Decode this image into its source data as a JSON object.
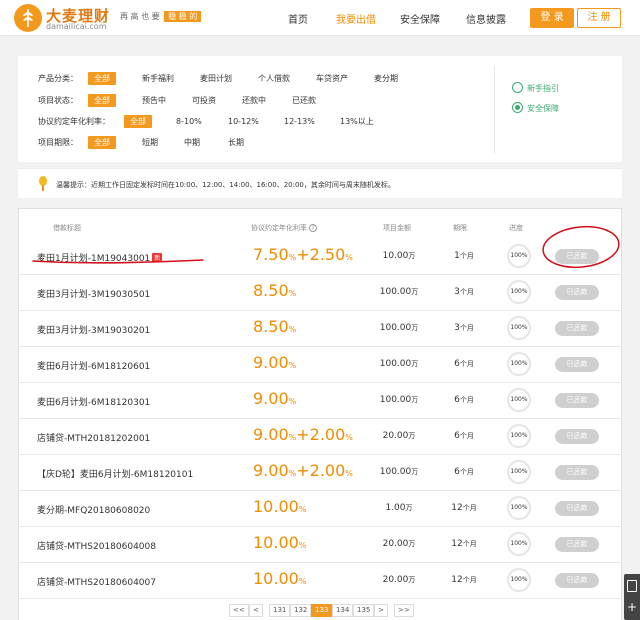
{
  "header": {
    "brand_name": "大麦理财",
    "brand_domain": "damailicai.com",
    "slogan": "再 高 也 要",
    "slogan_badge": "稳 稳 的",
    "nav": [
      {
        "label": "首页",
        "active": false
      },
      {
        "label": "我要出借",
        "active": true
      },
      {
        "label": "安全保障",
        "active": false
      },
      {
        "label": "信息披露",
        "active": false
      }
    ],
    "login_label": "登 录",
    "register_label": "注 册"
  },
  "filters": {
    "category": {
      "label": "产品分类：",
      "options": [
        "全部",
        "新手福利",
        "麦田计划",
        "个人借款",
        "车贷资产",
        "麦分期"
      ],
      "selected": "全部"
    },
    "status": {
      "label": "项目状态：",
      "options": [
        "全部",
        "预告中",
        "可投资",
        "还款中",
        "已还款"
      ],
      "selected": "全部"
    },
    "rate": {
      "label": "协议约定年化利率：",
      "options": [
        "全部",
        "8-10%",
        "10-12%",
        "12-13%",
        "13%以上"
      ],
      "selected": "全部"
    },
    "term": {
      "label": "项目期限：",
      "options": [
        "全部",
        "短期",
        "中期",
        "长期"
      ],
      "selected": "全部"
    }
  },
  "side_links": [
    "新手指引",
    "安全保障"
  ],
  "notice": "温馨提示：近期工作日固定发标时间在10:00、12:00、14:00、16:00、20:00，其余时间与周末随机发标。",
  "table": {
    "headers": {
      "name": "借款标题",
      "rate": "协议约定年化利率",
      "rate_help": "?",
      "amount": "项目金额",
      "term": "期限",
      "progress": "进度"
    },
    "rows": [
      {
        "name": "麦田1月计划-1M19043001",
        "is_new": true,
        "new_label": "新",
        "rate": "7.50",
        "bonus": "2.50",
        "amount": "10.00",
        "amount_unit": "万",
        "term": "1",
        "term_unit": "个月",
        "progress": "100%",
        "progress_value": 1.0,
        "status": "已还款"
      },
      {
        "name": "麦田3月计划-3M19030501",
        "is_new": false,
        "rate": "8.50",
        "bonus": "",
        "amount": "100.00",
        "amount_unit": "万",
        "term": "3",
        "term_unit": "个月",
        "progress": "100%",
        "progress_value": 1.0,
        "status": "已还款"
      },
      {
        "name": "麦田3月计划-3M19030201",
        "is_new": false,
        "rate": "8.50",
        "bonus": "",
        "amount": "100.00",
        "amount_unit": "万",
        "term": "3",
        "term_unit": "个月",
        "progress": "100%",
        "progress_value": 1.0,
        "status": "已还款"
      },
      {
        "name": "麦田6月计划-6M18120601",
        "is_new": false,
        "rate": "9.00",
        "bonus": "",
        "amount": "100.00",
        "amount_unit": "万",
        "term": "6",
        "term_unit": "个月",
        "progress": "100%",
        "progress_value": 1.0,
        "status": "已还款"
      },
      {
        "name": "麦田6月计划-6M18120301",
        "is_new": false,
        "rate": "9.00",
        "bonus": "",
        "amount": "100.00",
        "amount_unit": "万",
        "term": "6",
        "term_unit": "个月",
        "progress": "100%",
        "progress_value": 1.0,
        "status": "已还款"
      },
      {
        "name": "店铺贷-MTH20181202001",
        "is_new": false,
        "rate": "9.00",
        "bonus": "2.00",
        "amount": "20.00",
        "amount_unit": "万",
        "term": "6",
        "term_unit": "个月",
        "progress": "100%",
        "progress_value": 1.0,
        "status": "已还款"
      },
      {
        "name": "【庆D轮】麦田6月计划-6M18120101",
        "is_new": false,
        "rate": "9.00",
        "bonus": "2.00",
        "amount": "100.00",
        "amount_unit": "万",
        "term": "6",
        "term_unit": "个月",
        "progress": "100%",
        "progress_value": 1.0,
        "status": "已还款"
      },
      {
        "name": "麦分期-MFQ20180608020",
        "is_new": false,
        "rate": "10.00",
        "bonus": "",
        "amount": "1.00",
        "amount_unit": "万",
        "term": "12",
        "term_unit": "个月",
        "progress": "100%",
        "progress_value": 1.0,
        "status": "已还款"
      },
      {
        "name": "店铺贷-MTHS20180604008",
        "is_new": false,
        "rate": "10.00",
        "bonus": "",
        "amount": "20.00",
        "amount_unit": "万",
        "term": "12",
        "term_unit": "个月",
        "progress": "100%",
        "progress_value": 1.0,
        "status": "已还款"
      },
      {
        "name": "店铺贷-MTHS20180604007",
        "is_new": false,
        "rate": "10.00",
        "bonus": "",
        "amount": "20.00",
        "amount_unit": "万",
        "term": "12",
        "term_unit": "个月",
        "progress": "100%",
        "progress_value": 1.0,
        "status": "已还款"
      }
    ]
  },
  "pagination": {
    "first": "<<",
    "prev": "<",
    "pages": [
      "131",
      "132",
      "133",
      "134",
      "135"
    ],
    "current": "133",
    "next": ">",
    "last": ">>"
  },
  "colors": {
    "accent": "#f39a1e",
    "accent_text": "#f08c00",
    "annotation": "#d0101a",
    "green": "#3aa96f"
  }
}
